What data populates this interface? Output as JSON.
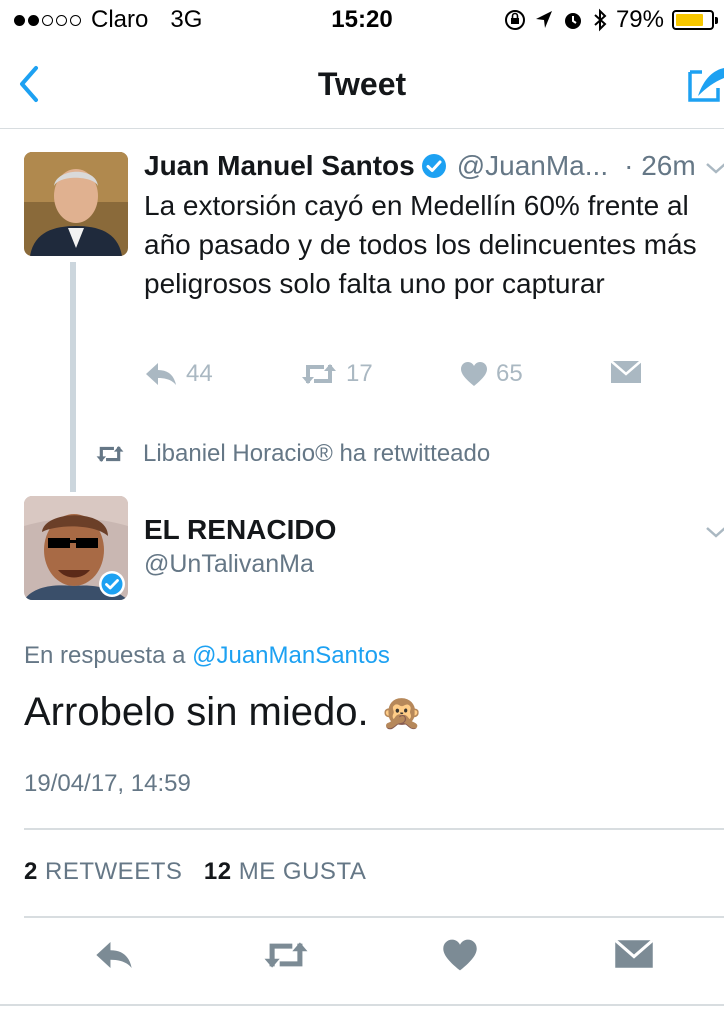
{
  "status_bar": {
    "carrier": "Claro",
    "network": "3G",
    "time": "15:20",
    "battery": "79%",
    "battery_level": 0.79,
    "signal_bars_filled": 2,
    "signal_bars_total": 5
  },
  "nav": {
    "title": "Tweet"
  },
  "parent_tweet": {
    "author_name": "Juan Manuel Santos",
    "author_handle": "@JuanMa...",
    "time": "· 26m",
    "text": "La extorsión cayó en Medellín 60% frente al año pasado y de todos los delincuentes más peligrosos solo falta uno por capturar",
    "replies": "44",
    "retweets": "17",
    "likes": "65"
  },
  "retweet_context": "Libaniel Horacio® ha retwitteado",
  "main_tweet": {
    "author_name": "EL RENACIDO",
    "author_handle": "@UnTalivanMa",
    "reply_prefix": "En respuesta a",
    "reply_to": "@JuanManSantos",
    "text": "Arrobelo sin miedo.",
    "emoji": "🙊",
    "timestamp": "19/04/17, 14:59",
    "retweets_count": "2",
    "retweets_label": "RETWEETS",
    "likes_count": "12",
    "likes_label": "ME GUSTA"
  },
  "colors": {
    "accent": "#1da1f2",
    "muted": "#657786",
    "icon_gray": "#aab8c2",
    "action_gray": "#7c8b95"
  }
}
